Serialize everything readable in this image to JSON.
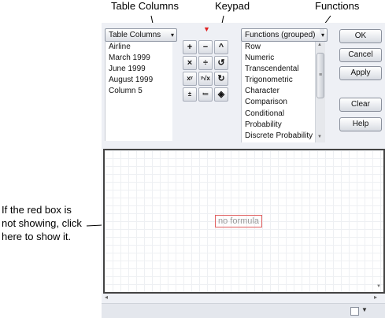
{
  "callouts": {
    "table_columns": "Table Columns",
    "keypad": "Keypad",
    "functions": "Functions",
    "note_lines": [
      "If the red box is",
      "not showing, click",
      "here to show it."
    ]
  },
  "table_columns_dropdown": "Table Columns",
  "columns": [
    "Airline",
    "March 1999",
    "June 1999",
    "August 1999",
    "Column 5"
  ],
  "keypad": {
    "red_indicator": "▼",
    "keys": [
      "+",
      "−",
      "^",
      "×",
      "÷",
      "↺",
      "xʸ",
      "ʸ√x",
      "↻",
      "±",
      "≔",
      "◈"
    ]
  },
  "functions_dropdown": "Functions (grouped)",
  "functions": [
    "Row",
    "Numeric",
    "Transcendental",
    "Trigonometric",
    "Character",
    "Comparison",
    "Conditional",
    "Probability",
    "Discrete Probability"
  ],
  "buttons": {
    "ok": "OK",
    "cancel": "Cancel",
    "apply": "Apply",
    "clear": "Clear",
    "help": "Help"
  },
  "editor": {
    "formula_placeholder": "no formula"
  },
  "icons": {
    "dropdown": "▾",
    "scroll_up": "▲",
    "scroll_down": "▼",
    "scroll_left": "◂",
    "scroll_right": "▸",
    "menu": "▼"
  },
  "colors": {
    "red_box": "#e06060",
    "indicator": "#e02020"
  }
}
